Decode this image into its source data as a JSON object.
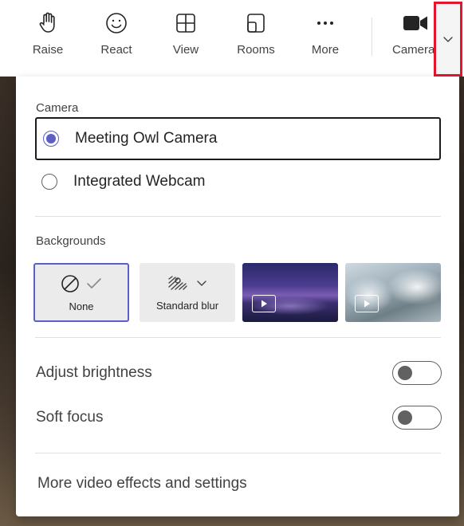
{
  "toolbar": {
    "raise_label": "Raise",
    "react_label": "React",
    "view_label": "View",
    "rooms_label": "Rooms",
    "more_label": "More",
    "camera_label": "Camera",
    "highlight_color": "#e3162d"
  },
  "camera_section": {
    "title": "Camera",
    "options": [
      {
        "label": "Meeting Owl Camera",
        "selected": true
      },
      {
        "label": "Integrated Webcam",
        "selected": false
      }
    ]
  },
  "backgrounds_section": {
    "title": "Backgrounds",
    "tiles": [
      {
        "label": "None",
        "selected": true
      },
      {
        "label": "Standard blur",
        "selected": false
      }
    ]
  },
  "toggles": {
    "adjust_brightness": {
      "label": "Adjust brightness",
      "on": false
    },
    "soft_focus": {
      "label": "Soft focus",
      "on": false
    }
  },
  "more_link": "More video effects and settings",
  "accent_color": "#5b5fc7"
}
